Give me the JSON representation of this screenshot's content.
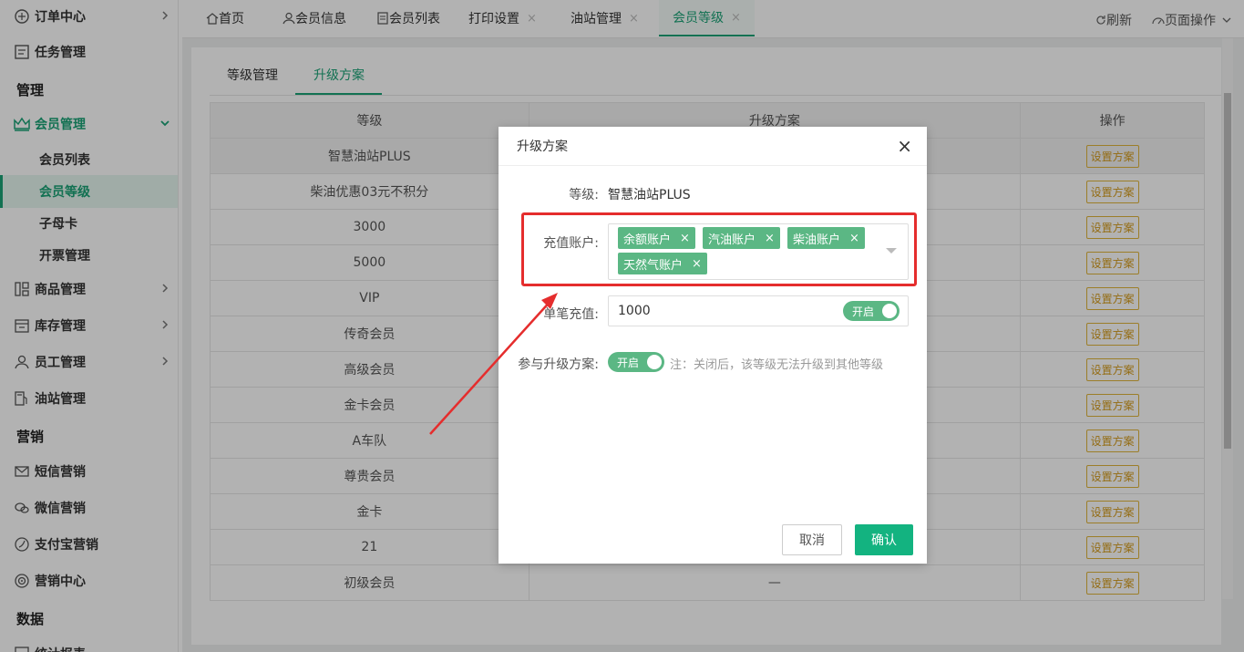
{
  "sidebar": {
    "top_items": [
      {
        "label": "订单中心",
        "icon": "order-icon"
      },
      {
        "label": "任务管理",
        "icon": "task-icon"
      }
    ],
    "group_manage": "管理",
    "member_manage": "会员管理",
    "member_subs": [
      "会员列表",
      "会员等级",
      "子母卡",
      "开票管理"
    ],
    "mid_items": [
      {
        "label": "商品管理",
        "icon": "goods-icon"
      },
      {
        "label": "库存管理",
        "icon": "inventory-icon"
      },
      {
        "label": "员工管理",
        "icon": "staff-icon"
      },
      {
        "label": "油站管理",
        "icon": "station-icon"
      }
    ],
    "group_marketing": "营销",
    "marketing_items": [
      {
        "label": "短信营销",
        "icon": "sms-icon"
      },
      {
        "label": "微信营销",
        "icon": "wechat-icon"
      },
      {
        "label": "支付宝营销",
        "icon": "alipay-icon"
      },
      {
        "label": "营销中心",
        "icon": "target-icon"
      }
    ],
    "group_data": "数据",
    "data_items": [
      {
        "label": "统计报表",
        "icon": "report-icon"
      }
    ]
  },
  "topbar": {
    "tabs": [
      {
        "label": "首页",
        "icon": "home-icon"
      },
      {
        "label": "会员信息",
        "icon": "user-icon"
      },
      {
        "label": "会员列表",
        "icon": "doc-icon"
      },
      {
        "label": "打印设置",
        "close": "×"
      },
      {
        "label": "油站管理",
        "close": "×"
      },
      {
        "label": "会员等级",
        "close": "×"
      }
    ],
    "refresh": "刷新",
    "page_ops": "页面操作"
  },
  "subtabs": [
    "等级管理",
    "升级方案"
  ],
  "table": {
    "headers": [
      "等级",
      "升级方案",
      "操作"
    ],
    "action_label": "设置方案",
    "rows": [
      {
        "level": "智慧油站PLUS",
        "plan": ""
      },
      {
        "level": "柴油优惠03元不积分",
        "plan": ""
      },
      {
        "level": "3000",
        "plan": ""
      },
      {
        "level": "5000",
        "plan": ""
      },
      {
        "level": "VIP",
        "plan": ""
      },
      {
        "level": "传奇会员",
        "plan": ""
      },
      {
        "level": "高级会员",
        "plan": ""
      },
      {
        "level": "金卡会员",
        "plan": ""
      },
      {
        "level": "A车队",
        "plan": ""
      },
      {
        "level": "尊贵会员",
        "plan": ""
      },
      {
        "level": "金卡",
        "plan": ""
      },
      {
        "level": "21",
        "plan": ""
      },
      {
        "level": "初级会员",
        "plan": "—"
      }
    ]
  },
  "modal": {
    "title": "升级方案",
    "close": "×",
    "level_label": "等级:",
    "level_value": "智慧油站PLUS",
    "account_label": "充值账户:",
    "accounts": [
      "余额账户",
      "汽油账户",
      "柴油账户",
      "天然气账户"
    ],
    "tag_close": "×",
    "single_label": "单笔充值:",
    "single_value": "1000",
    "switch_on": "开启",
    "join_label": "参与升级方案:",
    "note": "注：关闭后，该等级无法升级到其他等级",
    "cancel": "取消",
    "confirm": "确认"
  },
  "colors": {
    "accent": "#1aa276",
    "tag": "#5bb784",
    "annotation": "#e52d2d",
    "action_border": "#e0b53c"
  }
}
